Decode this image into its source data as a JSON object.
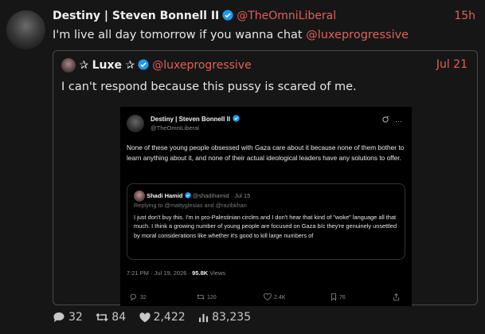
{
  "post": {
    "author_name": "Destiny | Steven Bonnell II",
    "author_handle": "@TheOmniLiberal",
    "time": "15h",
    "text_before": "I'm live all day tomorrow if you wanna chat ",
    "mention": "@luxeprogressive"
  },
  "quote": {
    "star_left": "✰",
    "author_name": "Luxe",
    "star_right": "✰",
    "author_handle": "@luxeprogressive",
    "time": "Jul 21",
    "text": "I can't respond because this pussy is scared of me."
  },
  "screenshot": {
    "author_name": "Destiny | Steven Bonnell II",
    "author_handle": "@TheOmniLiberal",
    "text": "None of these young people obsessed with Gaza care about it because none of them bother to learn anything about it, and none of their actual ideological leaders have any solutions to offer.",
    "inner": {
      "author_name": "Shadi Hamid",
      "author_handle": "@shadihamid",
      "date": "· Jul 15",
      "reply_line": "Replying to @mattyglesias and @razibkhan",
      "text": "I just don't buy this. I'm in pro-Palestinian circles and I don't hear that kind of \"woke\" language all that much. I think a growing number of young people are focused on Gaza b/c they're genuinely unsettled by moral considerations like whether it's good to kill large numbers of"
    },
    "meta_time": "7:21 PM · Jul 19, 2026 · ",
    "meta_views_count": "95.8K",
    "meta_views_label": " Views",
    "actions": {
      "replies": "32",
      "reposts": "120",
      "likes": "2.4K",
      "bookmarks": "76"
    }
  },
  "footer": {
    "replies": "32",
    "reposts": "84",
    "likes": "2,422",
    "views": "83,235"
  },
  "colors": {
    "background": "#161616",
    "accent": "#e0605a",
    "verified": "#1d9bf0"
  }
}
